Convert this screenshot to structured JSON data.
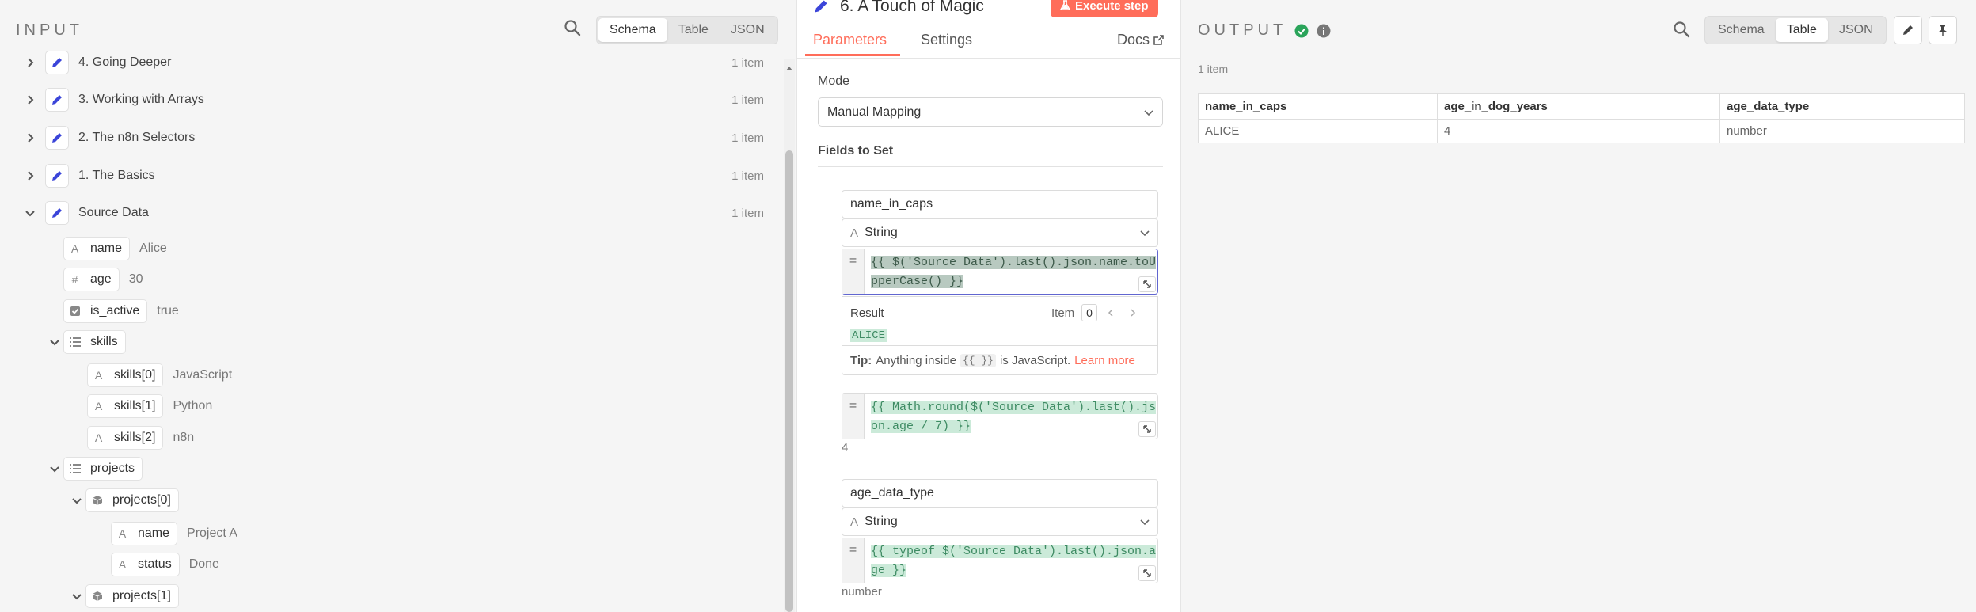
{
  "input": {
    "title": "INPUT",
    "view_tabs": [
      "Schema",
      "Table",
      "JSON"
    ],
    "nodes": [
      {
        "label": "4. Going Deeper",
        "count": "1 item"
      },
      {
        "label": "3. Working with Arrays",
        "count": "1 item"
      },
      {
        "label": "2. The n8n Selectors",
        "count": "1 item"
      },
      {
        "label": "1. The Basics",
        "count": "1 item"
      },
      {
        "label": "Source Data",
        "count": "1 item"
      }
    ],
    "fields": {
      "name": {
        "type": "A",
        "key": "name",
        "value": "Alice"
      },
      "age": {
        "type": "#",
        "key": "age",
        "value": "30"
      },
      "is_active": {
        "type": "check",
        "key": "is_active",
        "value": "true"
      },
      "skills": {
        "type": "list",
        "key": "skills"
      },
      "skills0": {
        "type": "A",
        "key": "skills[0]",
        "value": "JavaScript"
      },
      "skills1": {
        "type": "A",
        "key": "skills[1]",
        "value": "Python"
      },
      "skills2": {
        "type": "A",
        "key": "skills[2]",
        "value": "n8n"
      },
      "projects": {
        "type": "list",
        "key": "projects"
      },
      "projects0": {
        "type": "object",
        "key": "projects[0]"
      },
      "p_name": {
        "type": "A",
        "key": "name",
        "value": "Project A"
      },
      "p_status": {
        "type": "A",
        "key": "status",
        "value": "Done"
      },
      "projects1": {
        "type": "object",
        "key": "projects[1]"
      }
    }
  },
  "node_panel": {
    "title": "6. A Touch of Magic",
    "execute_label": "Execute step",
    "tabs": [
      "Parameters",
      "Settings"
    ],
    "docs_label": "Docs",
    "mode_label": "Mode",
    "mode_value": "Manual Mapping",
    "fields_label": "Fields to Set",
    "assignments": [
      {
        "name": "name_in_caps",
        "type": "String",
        "expr_line1": "{{ $('Source Data').last().json.name.toU",
        "expr_line2": "pperCase() }}",
        "result_label": "Result",
        "item_label": "Item",
        "item_index": "0",
        "result_value": "ALICE",
        "tip_label": "Tip:",
        "tip_text1": "Anything inside",
        "tip_code": "{{ }}",
        "tip_text2": "is JavaScript.",
        "tip_link": "Learn more"
      },
      {
        "expr_line1": "{{ Math.round($('Source Data').last().js",
        "expr_line2": "on.age / 7) }}",
        "result_value": "4"
      },
      {
        "name": "age_data_type",
        "type": "String",
        "expr_line1": "{{ typeof $('Source Data').last().json.a",
        "expr_line2": "ge }}",
        "result_value": "number"
      }
    ],
    "eq_sign": "="
  },
  "output": {
    "title": "OUTPUT",
    "items_count": "1 item",
    "view_tabs": [
      "Schema",
      "Table",
      "JSON"
    ],
    "columns": [
      "name_in_caps",
      "age_in_dog_years",
      "age_data_type"
    ],
    "rows": [
      [
        "ALICE",
        "4",
        "number"
      ]
    ]
  },
  "colors": {
    "accent": "#ff6d5a",
    "node_icon": "#3b45d9",
    "success": "#2aa45a",
    "expression_bg": "#cbead9",
    "expression_text": "#3e8b63",
    "focus_border": "#6166d0"
  },
  "icons": {
    "search": "search-icon",
    "pencil": "pencil-icon",
    "pin": "pin-icon",
    "flask": "flask-icon",
    "external": "external-link-icon",
    "expand": "expand-icon"
  }
}
